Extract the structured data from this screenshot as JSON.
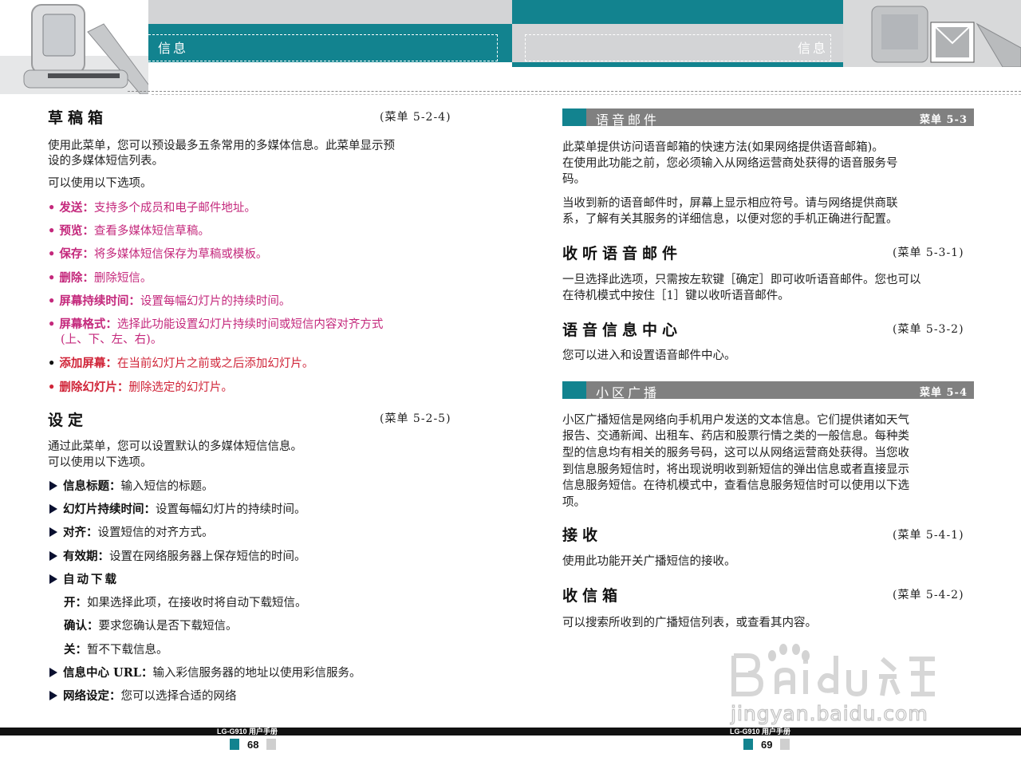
{
  "header": {
    "left_title": "信息",
    "right_title": "信息"
  },
  "left": {
    "drafts": {
      "title": "草稿箱",
      "menu": "(菜单 5-2-4)",
      "p1a": "使用此菜单，您可以预设最多五条常用的多媒体信息。此菜单显示预",
      "p1b": "设的多媒体短信列表。",
      "p2": "可以使用以下选项。",
      "bullets": [
        {
          "term": "发送：",
          "text": "支持多个成员和电子邮件地址。"
        },
        {
          "term": "预览：",
          "text": "查看多媒体短信草稿。"
        },
        {
          "term": "保存：",
          "text": "将多媒体短信保存为草稿或模板。"
        },
        {
          "term": "删除：",
          "text": "删除短信。"
        },
        {
          "term": "屏幕持续时间：",
          "text": "设置每幅幻灯片的持续时间。"
        },
        {
          "term": "屏幕格式：",
          "text": "选择此功能设置幻灯片持续时间或短信内容对齐方式"
        },
        {
          "term": "",
          "text": "(上、下、左、右)。"
        },
        {
          "term": "添加屏幕：",
          "text": "在当前幻灯片之前或之后添加幻灯片。"
        },
        {
          "term": "删除幻灯片：",
          "text": "删除选定的幻灯片。"
        }
      ]
    },
    "settings": {
      "title": "设定",
      "menu": "(菜单 5-2-5)",
      "p1a": "通过此菜单，您可以设置默认的多媒体短信信息。",
      "p1b": "可以使用以下选项。",
      "items": [
        {
          "term": "信息标题：",
          "text": "输入短信的标题。"
        },
        {
          "term": "幻灯片持续时间：",
          "text": "设置每幅幻灯片的持续时间。"
        },
        {
          "term": "对齐：",
          "text": "设置短信的对齐方式。"
        },
        {
          "term": "有效期：",
          "text": "设置在网络服务器上保存短信的时间。"
        },
        {
          "term": "自动下载",
          "text": ""
        }
      ],
      "sub": [
        {
          "term": "开：",
          "text": "如果选择此项，在接收时将自动下载短信。"
        },
        {
          "term": "确认：",
          "text": "要求您确认是否下载短信。"
        },
        {
          "term": "关：",
          "text": "暂不下载信息。"
        }
      ],
      "items2": [
        {
          "term": "信息中心 URL：",
          "text": "输入彩信服务器的地址以使用彩信服务。"
        },
        {
          "term": "网络设定：",
          "text": "您可以选择合适的网络"
        }
      ]
    }
  },
  "right": {
    "voicemail_bar": {
      "title": "语音邮件",
      "menu": "菜单 5-3"
    },
    "vm_p1a": "此菜单提供访问语音邮箱的快速方法(如果网络提供语音邮箱)。",
    "vm_p1b": "在使用此功能之前，您必须输入从网络运营商处获得的语音服务号",
    "vm_p1c": "码。",
    "vm_p2a": "当收到新的语音邮件时，屏幕上显示相应符号。请与网络提供商联",
    "vm_p2b": "系，了解有关其服务的详细信息，以便对您的手机正确进行配置。",
    "listen": {
      "title": "收听语音邮件",
      "menu": "(菜单 5-3-1)",
      "pa": "一旦选择此选项，只需按左软键［确定］即可收听语音邮件。您也可以",
      "pb": "在待机模式中按住［1］键以收听语音邮件。"
    },
    "center": {
      "title": "语音信息中心",
      "menu": "(菜单 5-3-2)",
      "p": "您可以进入和设置语音邮件中心。"
    },
    "cb_bar": {
      "title": "小区广播",
      "menu": "菜单 5-4"
    },
    "cb_lines": [
      "小区广播短信是网络向手机用户发送的文本信息。它们提供诸如天气",
      "报告、交通新闻、出租车、药店和股票行情之类的一般信息。每种类",
      "型的信息均有相关的服务号码，这可以从网络运营商处获得。当您收",
      "到信息服务短信时，将出现说明收到新短信的弹出信息或者直接显示",
      "信息服务短信。在待机模式中，查看信息服务短信时可以使用以下选",
      "项。"
    ],
    "receive": {
      "title": "接收",
      "menu": "(菜单 5-4-1)",
      "p": "使用此功能开关广播短信的接收。"
    },
    "inbox": {
      "title": "收信箱",
      "menu": "(菜单 5-4-2)",
      "p": "可以搜索所收到的广播短信列表，或查看其内容。"
    }
  },
  "footer": {
    "manual_left": "LG-G910 用户手册",
    "manual_right": "LG-G910 用户手册",
    "page_left": "68",
    "page_right": "69"
  },
  "watermark": {
    "brand": "Bai du 经验",
    "url": "jingyan.baidu.com"
  }
}
